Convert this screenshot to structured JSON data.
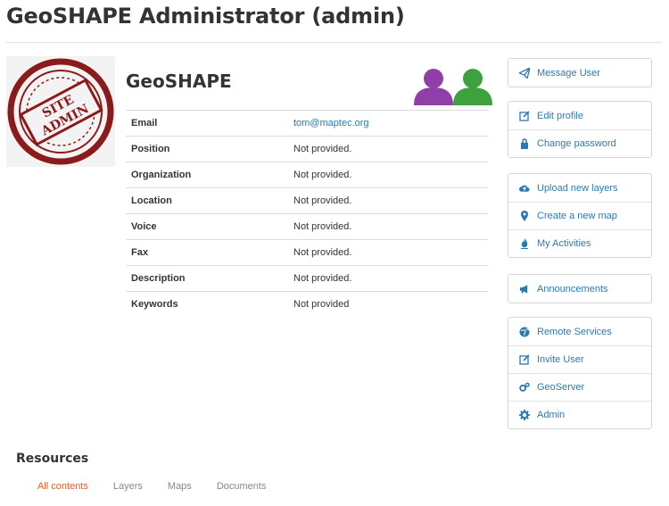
{
  "page": {
    "title": "GeoSHAPE Administrator (admin)"
  },
  "stamp": {
    "line1": "SITE",
    "line2": "ADMIN"
  },
  "profile": {
    "name": "GeoSHAPE",
    "fields": [
      {
        "label": "Email",
        "value": "tom@maptec.org",
        "link": true
      },
      {
        "label": "Position",
        "value": "Not provided."
      },
      {
        "label": "Organization",
        "value": "Not provided."
      },
      {
        "label": "Location",
        "value": "Not provided."
      },
      {
        "label": "Voice",
        "value": "Not provided."
      },
      {
        "label": "Fax",
        "value": "Not provided."
      },
      {
        "label": "Description",
        "value": "Not provided."
      },
      {
        "label": "Keywords",
        "value": "Not provided"
      }
    ]
  },
  "actions": {
    "group1": [
      {
        "label": "Message User",
        "icon": "paper-plane-icon"
      }
    ],
    "group2": [
      {
        "label": "Edit profile",
        "icon": "edit-icon"
      },
      {
        "label": "Change password",
        "icon": "lock-icon"
      }
    ],
    "group3": [
      {
        "label": "Upload new layers",
        "icon": "cloud-upload-icon"
      },
      {
        "label": "Create a new map",
        "icon": "map-marker-icon"
      },
      {
        "label": "My Activities",
        "icon": "fire-icon"
      }
    ],
    "group4": [
      {
        "label": "Announcements",
        "icon": "bullhorn-icon"
      }
    ],
    "group5": [
      {
        "label": "Remote Services",
        "icon": "globe-icon"
      },
      {
        "label": "Invite User",
        "icon": "edit-icon"
      },
      {
        "label": "GeoServer",
        "icon": "cogs-icon"
      },
      {
        "label": "Admin",
        "icon": "gear-icon"
      }
    ]
  },
  "resources": {
    "title": "Resources",
    "tabs": [
      "All contents",
      "Layers",
      "Maps",
      "Documents"
    ]
  },
  "colors": {
    "accent": "#2a7ab0",
    "active_tab": "#e05a2a",
    "stamp": "#8b1a1a",
    "person1": "#8e3fa8",
    "person2": "#3da23d"
  }
}
